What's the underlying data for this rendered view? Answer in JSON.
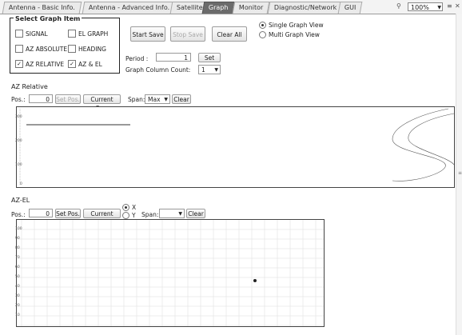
{
  "tabs": [
    {
      "label": "Antenna - Basic Info.",
      "active": false
    },
    {
      "label": "Antenna - Advanced Info.",
      "active": false
    },
    {
      "label": "Satellite",
      "active": false
    },
    {
      "label": "Graph",
      "active": true
    },
    {
      "label": "Monitor",
      "active": false
    },
    {
      "label": "Diagnostic/Network",
      "active": false
    },
    {
      "label": "GUI",
      "active": false
    }
  ],
  "zoom": "100%",
  "select_graph": {
    "title": "Select Graph Item",
    "items": [
      {
        "label": "SIGNAL",
        "checked": false
      },
      {
        "label": "EL GRAPH",
        "checked": false
      },
      {
        "label": "AZ ABSOLUTE",
        "checked": false
      },
      {
        "label": "HEADING",
        "checked": false
      },
      {
        "label": "AZ RELATIVE",
        "checked": true
      },
      {
        "label": "AZ & EL",
        "checked": true
      }
    ]
  },
  "buttons": {
    "start_save": "Start Save",
    "stop_save": "Stop Save",
    "clear_all": "Clear All"
  },
  "view": {
    "single": "Single Graph View",
    "multi": "Multi Graph View",
    "selected": "single"
  },
  "period": {
    "label": "Period :",
    "value": "1",
    "set": "Set"
  },
  "column_count": {
    "label": "Graph Column Count:",
    "value": "1"
  },
  "az_relative": {
    "title": "AZ Relative",
    "pos_label": "Pos.:",
    "pos_value": "0",
    "set_pos": "Set Pos.",
    "current_pos": "Current Pos.",
    "span_label": "Span:",
    "span_value": "Max",
    "clear": "Clear",
    "y_ticks": [
      "300",
      "200",
      "100",
      "0"
    ]
  },
  "az_el": {
    "title": "AZ-EL",
    "pos_label": "Pos.:",
    "pos_value": "0",
    "set_pos": "Set Pos.",
    "current_pos": "Current Pos.",
    "axis_x": "X",
    "axis_y": "Y",
    "axis_selected": "X",
    "span_label": "Span:",
    "span_value": "",
    "clear": "Clear",
    "y_ticks": [
      "100",
      "90",
      "80",
      "70",
      "60",
      "50",
      "40",
      "30",
      "20",
      "10"
    ]
  }
}
